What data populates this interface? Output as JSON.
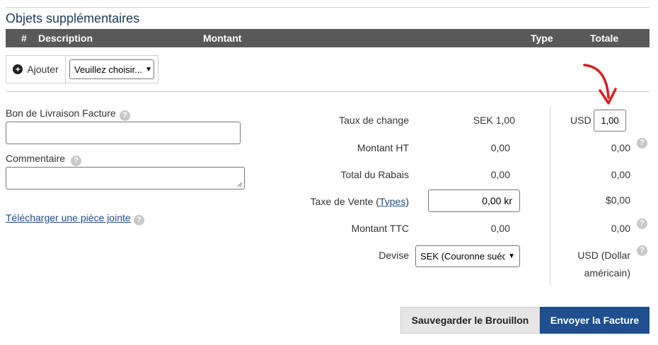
{
  "section": {
    "title": "Objets supplémentaires"
  },
  "table": {
    "headers": {
      "num": "#",
      "description": "Description",
      "amount": "Montant",
      "type": "Type",
      "total": "Totale"
    }
  },
  "add_bar": {
    "add_label": "Ajouter",
    "select_value": "Veuillez choisir..."
  },
  "left": {
    "delivery_label": "Bon de Livraison Facture",
    "comment_label": "Commentaire",
    "upload_link": "Télécharger une pièce jointe"
  },
  "summary": {
    "exchange_label": "Taux de change",
    "exchange_value": "SEK 1,00",
    "usd_label": "USD",
    "usd_rate": "1,00",
    "net_label": "Montant HT",
    "net_value": "0,00",
    "net_usd": "0,00",
    "discount_label": "Total du Rabais",
    "discount_value": "0,00",
    "discount_usd": "0,00",
    "tax_label": "Taxe de Vente (",
    "tax_link": "Types",
    "tax_close": ")",
    "tax_value": "0,00 kr",
    "tax_usd": "$0,00",
    "gross_label": "Montant TTC",
    "gross_value": "0,00",
    "gross_usd": "0,00",
    "currency_label": "Devise",
    "currency_select": "SEK (Couronne suédoise)",
    "currency_usd_line1": "USD (Dollar",
    "currency_usd_line2": "américain)"
  },
  "actions": {
    "save_draft": "Sauvegarder le Brouillon",
    "send": "Envoyer la Facture"
  },
  "colors": {
    "header_bg": "#595959",
    "primary": "#1f4f8f",
    "annotation_arrow": "#d42020"
  },
  "icons": {
    "help": "question-circle-icon",
    "add": "plus-circle-icon",
    "annotation": "red-arrow-icon"
  }
}
